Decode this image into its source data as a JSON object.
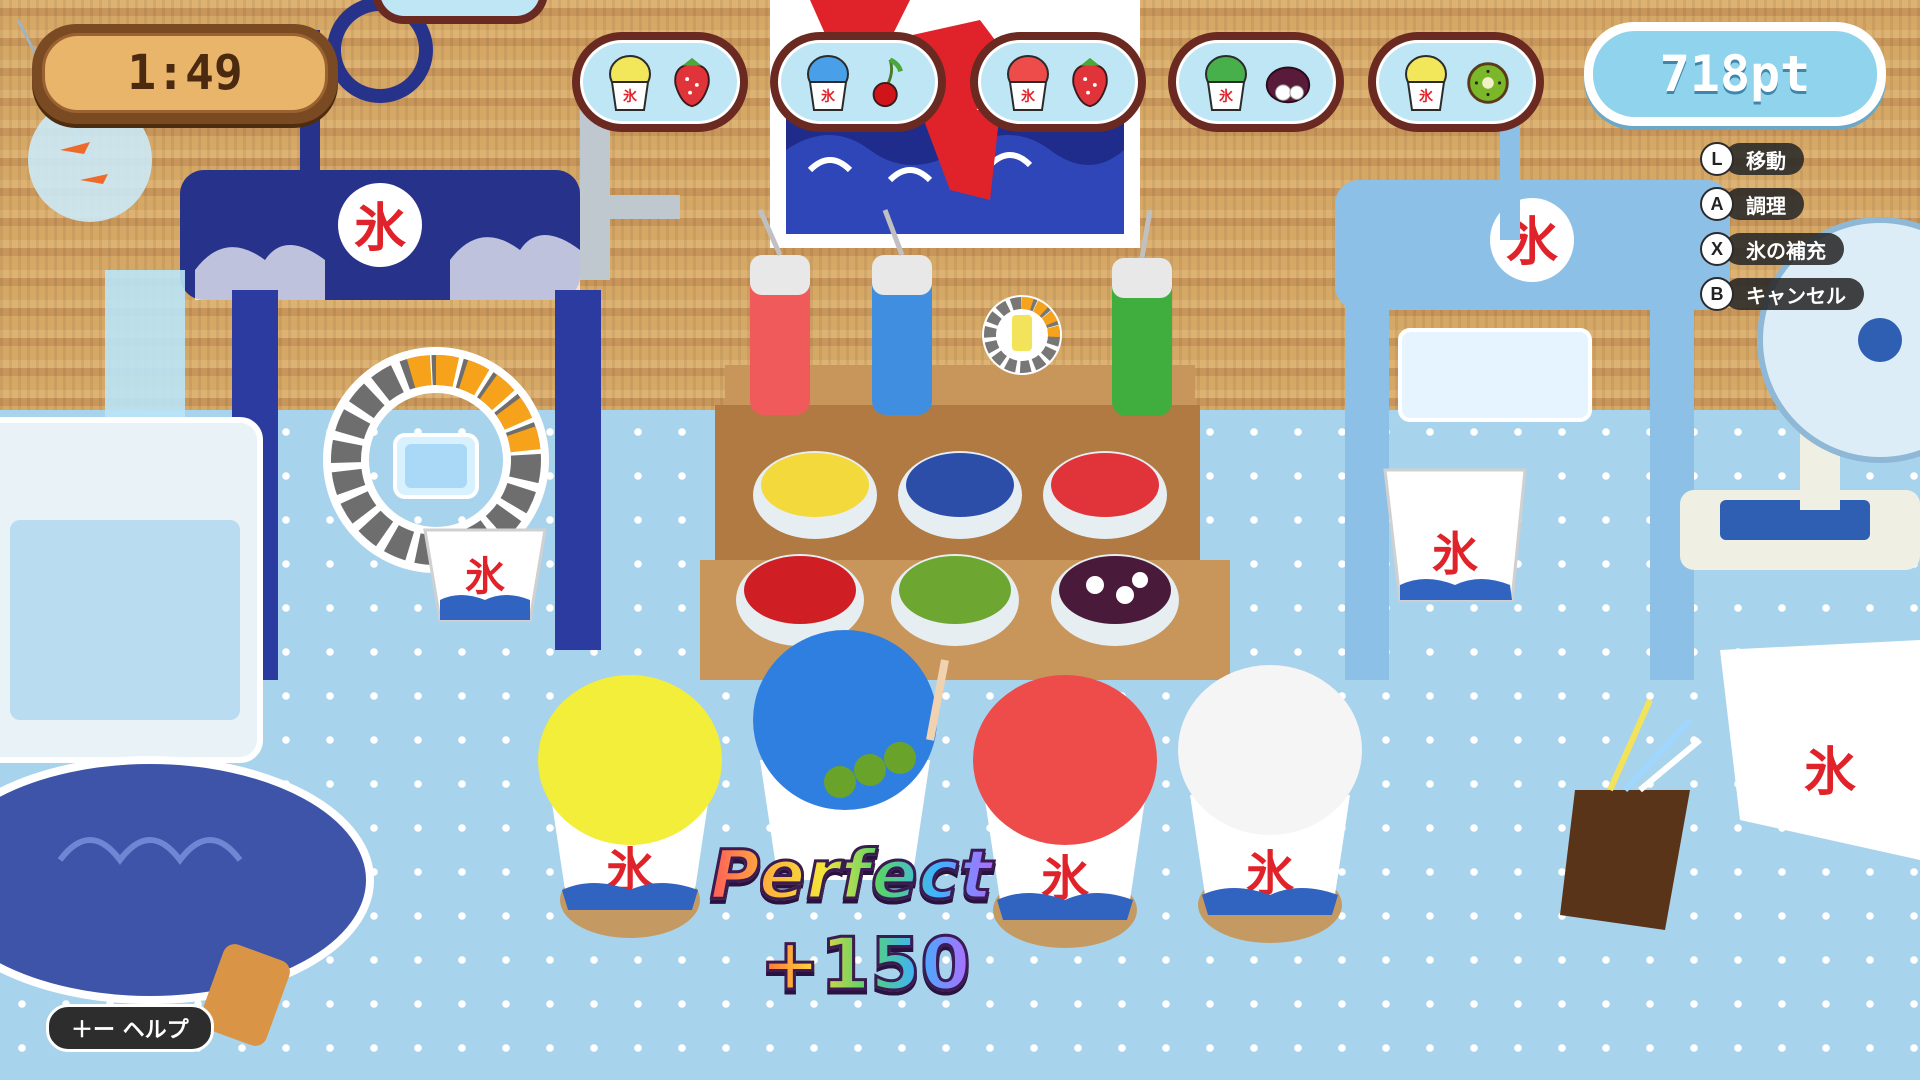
{
  "hud": {
    "timer": "1:49",
    "score": "718pt",
    "help_label": "＋ー ヘルプ"
  },
  "orders": [
    {
      "syrup": "lemon",
      "syrup_color": "#f2e65a",
      "topping": "strawberry-icon"
    },
    {
      "syrup": "blue-hawaii",
      "syrup_color": "#4aa0e8",
      "topping": "cherry-icon"
    },
    {
      "syrup": "strawberry",
      "syrup_color": "#ee4b4b",
      "topping": "strawberry-icon"
    },
    {
      "syrup": "melon",
      "syrup_color": "#47b04b",
      "topping": "anko-mochi-icon"
    },
    {
      "syrup": "lemon",
      "syrup_color": "#f2e65a",
      "topping": "kiwi-icon"
    }
  ],
  "controls": [
    {
      "button": "L",
      "label": "移動"
    },
    {
      "button": "A",
      "label": "調理"
    },
    {
      "button": "X",
      "label": "氷の補充"
    },
    {
      "button": "B",
      "label": "キャンセル"
    }
  ],
  "cup_logo": "氷",
  "gauges": {
    "ice_machine_level": 0.4,
    "syrup_level": 0.45
  },
  "feedback": {
    "rating": "Perfect",
    "points": "+150"
  },
  "colors": {
    "syrup_red": "#ee4b4b",
    "syrup_blue": "#3f8ee0",
    "syrup_green": "#3fae3f",
    "hud_score_bg": "#8fd3ec",
    "hud_timer_bg": "#e8b56a"
  }
}
